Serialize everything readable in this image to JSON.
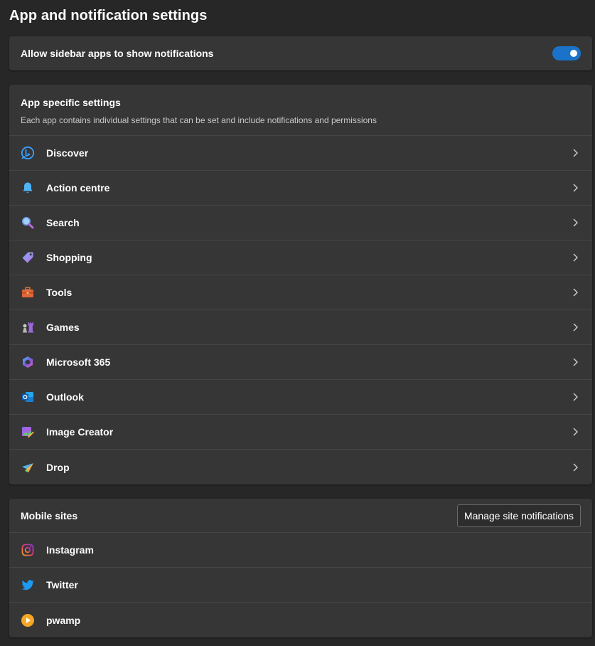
{
  "page": {
    "title": "App and notification settings"
  },
  "toggle": {
    "label": "Allow sidebar apps to show notifications",
    "on": true
  },
  "app_section": {
    "title": "App specific settings",
    "description": "Each app contains individual settings that can be set and include notifications and permissions",
    "items": [
      {
        "label": "Discover",
        "icon": "bing-icon"
      },
      {
        "label": "Action centre",
        "icon": "bell-icon"
      },
      {
        "label": "Search",
        "icon": "search-icon"
      },
      {
        "label": "Shopping",
        "icon": "tag-icon"
      },
      {
        "label": "Tools",
        "icon": "toolbox-icon"
      },
      {
        "label": "Games",
        "icon": "chess-icon"
      },
      {
        "label": "Microsoft 365",
        "icon": "m365-icon"
      },
      {
        "label": "Outlook",
        "icon": "outlook-icon"
      },
      {
        "label": "Image Creator",
        "icon": "image-creator-icon"
      },
      {
        "label": "Drop",
        "icon": "paper-plane-icon"
      }
    ]
  },
  "mobile_section": {
    "title": "Mobile sites",
    "manage_button": "Manage site notifications",
    "items": [
      {
        "label": "Instagram",
        "icon": "instagram-icon"
      },
      {
        "label": "Twitter",
        "icon": "twitter-icon"
      },
      {
        "label": "pwamp",
        "icon": "play-icon"
      }
    ]
  },
  "colors": {
    "background": "#272727",
    "card": "#363636",
    "accent": "#1a73c9",
    "divider": "#454545"
  }
}
